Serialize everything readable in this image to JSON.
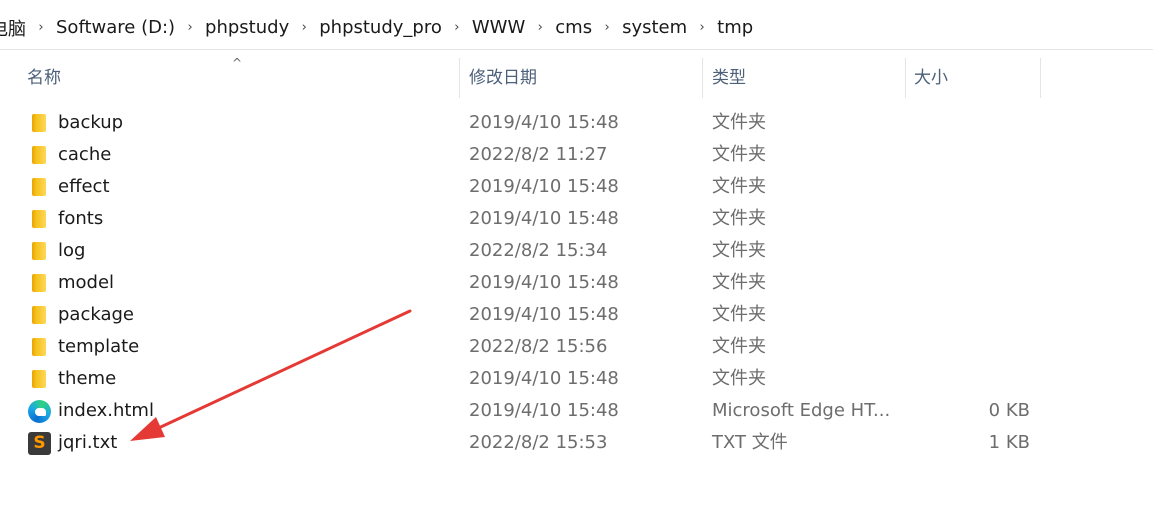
{
  "breadcrumb": {
    "items": [
      "电脑",
      "Software (D:)",
      "phpstudy",
      "phpstudy_pro",
      "WWW",
      "cms",
      "system",
      "tmp"
    ],
    "separator": "›"
  },
  "columns": {
    "name": "名称",
    "date": "修改日期",
    "type": "类型",
    "size": "大小",
    "sort_indicator": "^"
  },
  "files": [
    {
      "name": "backup",
      "date": "2019/4/10 15:48",
      "type": "文件夹",
      "size": "",
      "icon": "folder-icon"
    },
    {
      "name": "cache",
      "date": "2022/8/2 11:27",
      "type": "文件夹",
      "size": "",
      "icon": "folder-icon"
    },
    {
      "name": "effect",
      "date": "2019/4/10 15:48",
      "type": "文件夹",
      "size": "",
      "icon": "folder-icon"
    },
    {
      "name": "fonts",
      "date": "2019/4/10 15:48",
      "type": "文件夹",
      "size": "",
      "icon": "folder-icon"
    },
    {
      "name": "log",
      "date": "2022/8/2 15:34",
      "type": "文件夹",
      "size": "",
      "icon": "folder-icon"
    },
    {
      "name": "model",
      "date": "2019/4/10 15:48",
      "type": "文件夹",
      "size": "",
      "icon": "folder-icon"
    },
    {
      "name": "package",
      "date": "2019/4/10 15:48",
      "type": "文件夹",
      "size": "",
      "icon": "folder-icon"
    },
    {
      "name": "template",
      "date": "2022/8/2 15:56",
      "type": "文件夹",
      "size": "",
      "icon": "folder-icon"
    },
    {
      "name": "theme",
      "date": "2019/4/10 15:48",
      "type": "文件夹",
      "size": "",
      "icon": "folder-icon"
    },
    {
      "name": "index.html",
      "date": "2019/4/10 15:48",
      "type": "Microsoft Edge HT...",
      "size": "0 KB",
      "icon": "edge-icon"
    },
    {
      "name": "jqri.txt",
      "date": "2022/8/2 15:53",
      "type": "TXT 文件",
      "size": "1 KB",
      "icon": "sublime-text-icon"
    }
  ],
  "annotation": {
    "color": "#e53935",
    "icon": "red-arrow-annotation"
  },
  "colors": {
    "header_text": "#4c607a",
    "meta_text": "#6d6d6d",
    "folder": "#f5c11c"
  }
}
